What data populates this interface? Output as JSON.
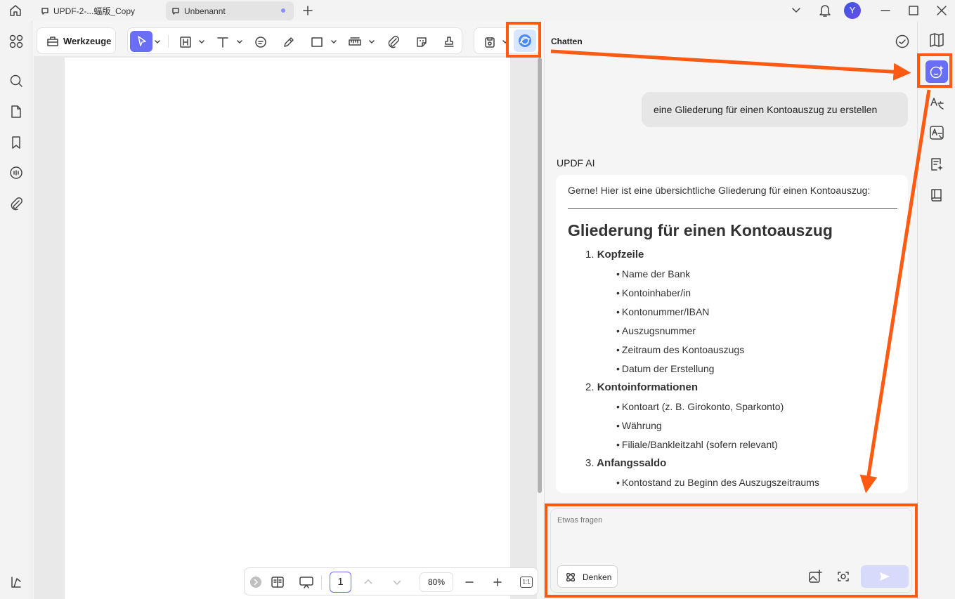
{
  "tabs": [
    {
      "label": "UPDF-2-...蝠版_Copy",
      "active": false
    },
    {
      "label": "Unbenannt",
      "active": true
    }
  ],
  "window": {
    "avatar_letter": "Y"
  },
  "toolbar": {
    "tools_label": "Werkzeuge"
  },
  "chat": {
    "title": "Chatten",
    "user_message": "eine Gliederung für einen Kontoauszug zu erstellen",
    "ai_name": "UPDF AI",
    "ai_intro": "Gerne! Hier ist eine übersichtliche Gliederung für einen Kontoauszug:",
    "ai_heading": "Gliederung für einen Kontoauszug",
    "sections": [
      {
        "num": "1.",
        "title": "Kopfzeile",
        "items": [
          "Name der Bank",
          "Kontoinhaber/in",
          "Kontonummer/IBAN",
          "Auszugsnummer",
          "Zeitraum des Kontoauszugs",
          "Datum der Erstellung"
        ]
      },
      {
        "num": "2.",
        "title": "Kontoinformationen",
        "items": [
          "Kontoart (z. B. Girokonto, Sparkonto)",
          "Währung",
          "Filiale/Bankleitzahl (sofern relevant)"
        ]
      },
      {
        "num": "3.",
        "title": "Anfangssaldo",
        "items": [
          "Kontostand zu Beginn des Auszugszeitraums"
        ]
      }
    ],
    "input_placeholder": "Etwas fragen",
    "think_label": "Denken"
  },
  "bottombar": {
    "page_number": "1",
    "zoom": "80%",
    "fit_label": "1:1"
  },
  "colors": {
    "accent": "#6a6ef5",
    "highlight": "#ff5a12"
  }
}
